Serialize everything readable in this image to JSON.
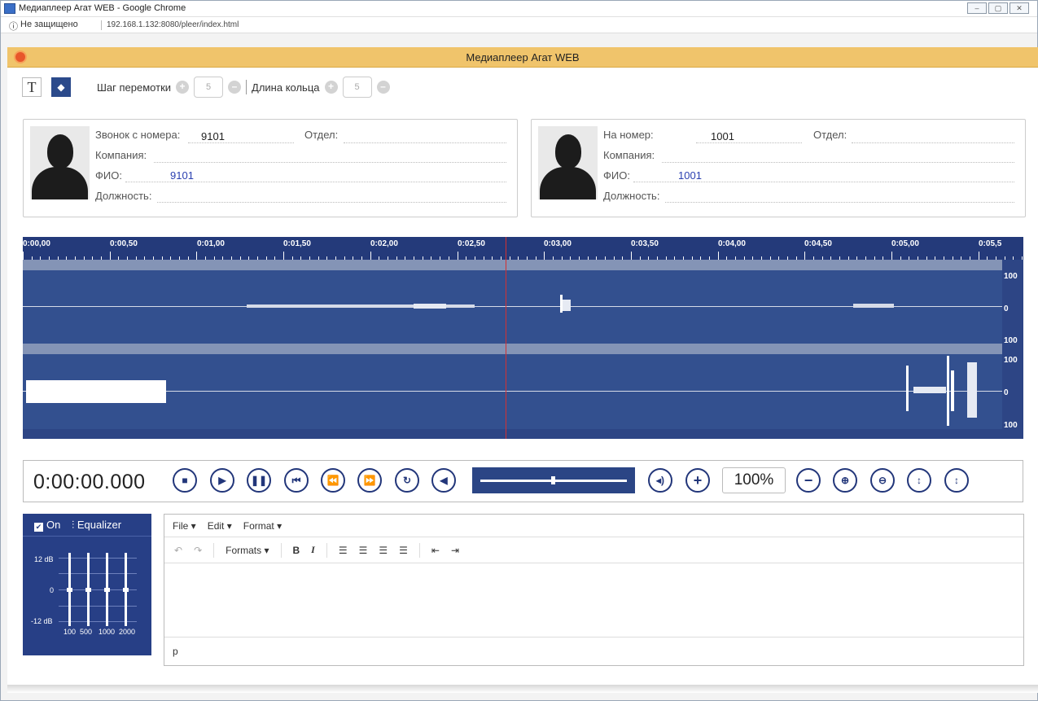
{
  "window": {
    "title": "Медиаплеер Агат WEB - Google Chrome",
    "security": "Не защищено",
    "url": "192.168.1.132:8080/pleer/index.html"
  },
  "app": {
    "title": "Медиаплеер Агат WEB"
  },
  "toolbar": {
    "text_button": "T",
    "rewind_step_label": "Шаг перемотки",
    "rewind_step_value": "5",
    "loop_length_label": "Длина кольца",
    "loop_length_value": "5"
  },
  "caller": {
    "from_label": "Звонок с номера:",
    "from_value": "9101",
    "dept_label": "Отдел:",
    "company_label": "Компания:",
    "name_label": "ФИО:",
    "name_value": "9101",
    "position_label": "Должность:"
  },
  "callee": {
    "to_label": "На номер:",
    "to_value": "1001",
    "dept_label": "Отдел:",
    "company_label": "Компания:",
    "name_label": "ФИО:",
    "name_value": "1001",
    "position_label": "Должность:"
  },
  "waveform": {
    "time_ticks": [
      "0:00,00",
      "0:00,50",
      "0:01,00",
      "0:01,50",
      "0:02,00",
      "0:02,50",
      "0:03,00",
      "0:03,50",
      "0:04,00",
      "0:04,50",
      "0:05,00",
      "0:05,5"
    ],
    "scale_top": "100",
    "scale_mid": "0",
    "scale_bottom": "100"
  },
  "player": {
    "time": "0:00:00.000",
    "zoom": "100%",
    "volume_percent": 50
  },
  "equalizer": {
    "on_label": "On",
    "title": "Equalizer",
    "db_top": "12 dB",
    "db_mid": "0",
    "db_bottom": "-12 dB",
    "bands": [
      "100",
      "500",
      "1000",
      "2000"
    ]
  },
  "editor": {
    "menu": [
      "File ▾",
      "Edit ▾",
      "Format ▾"
    ],
    "formats_label": "Formats ▾",
    "bold": "B",
    "italic": "I",
    "status_path": "p"
  },
  "colors": {
    "appbar": "#f0c46b",
    "accent": "#22367a",
    "wave_bg": "#2d4585"
  }
}
